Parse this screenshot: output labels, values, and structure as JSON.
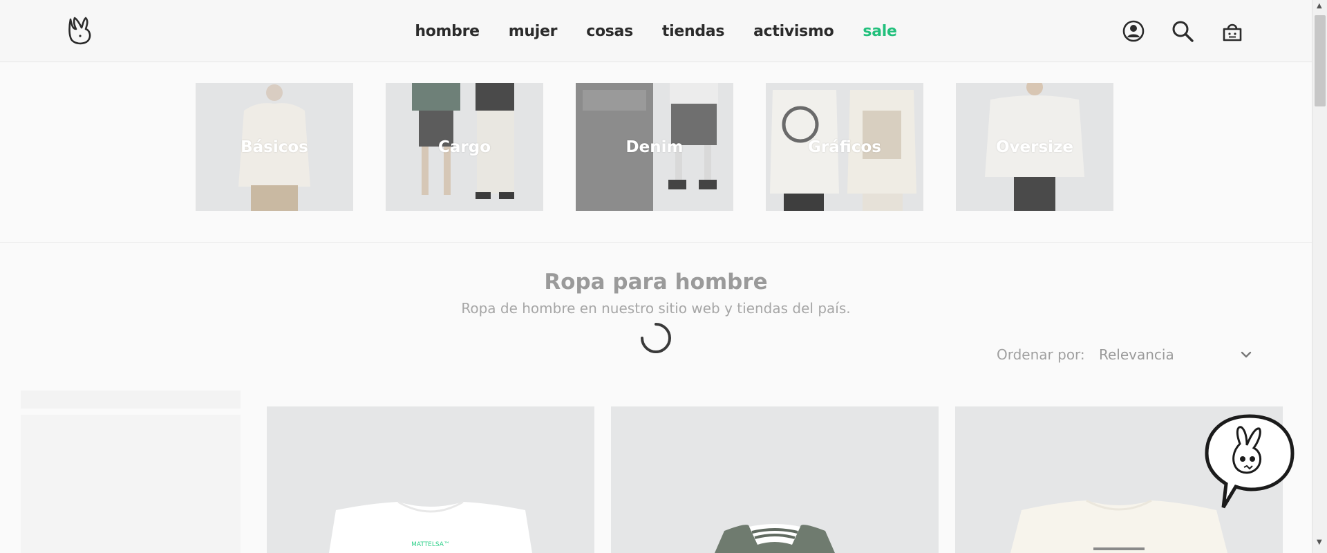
{
  "header": {
    "logo_icon": "rabbit-logo-icon",
    "nav": [
      {
        "label": "hombre"
      },
      {
        "label": "mujer"
      },
      {
        "label": "cosas"
      },
      {
        "label": "tiendas"
      },
      {
        "label": "activismo"
      },
      {
        "label": "sale"
      }
    ],
    "sale_color": "#22c07c",
    "icons": [
      "account-icon",
      "search-icon",
      "cart-icon"
    ]
  },
  "categories": [
    {
      "label": "Básicos"
    },
    {
      "label": "Cargo"
    },
    {
      "label": "Denim"
    },
    {
      "label": "Gráficos"
    },
    {
      "label": "Oversize"
    }
  ],
  "page": {
    "title": "Ropa para hombre",
    "subtitle": "Ropa de hombre en nuestro sitio web y tiendas del país."
  },
  "sort": {
    "label": "Ordenar por:",
    "value": "Relevancia"
  },
  "products": [
    {
      "print_text": "MATTELSA™"
    },
    {
      "print_text": ""
    },
    {
      "print_text": ""
    }
  ],
  "chat": {
    "icon": "rabbit-chat-icon"
  },
  "colors": {
    "accent": "#22c07c",
    "text": "#2b2b2b"
  }
}
